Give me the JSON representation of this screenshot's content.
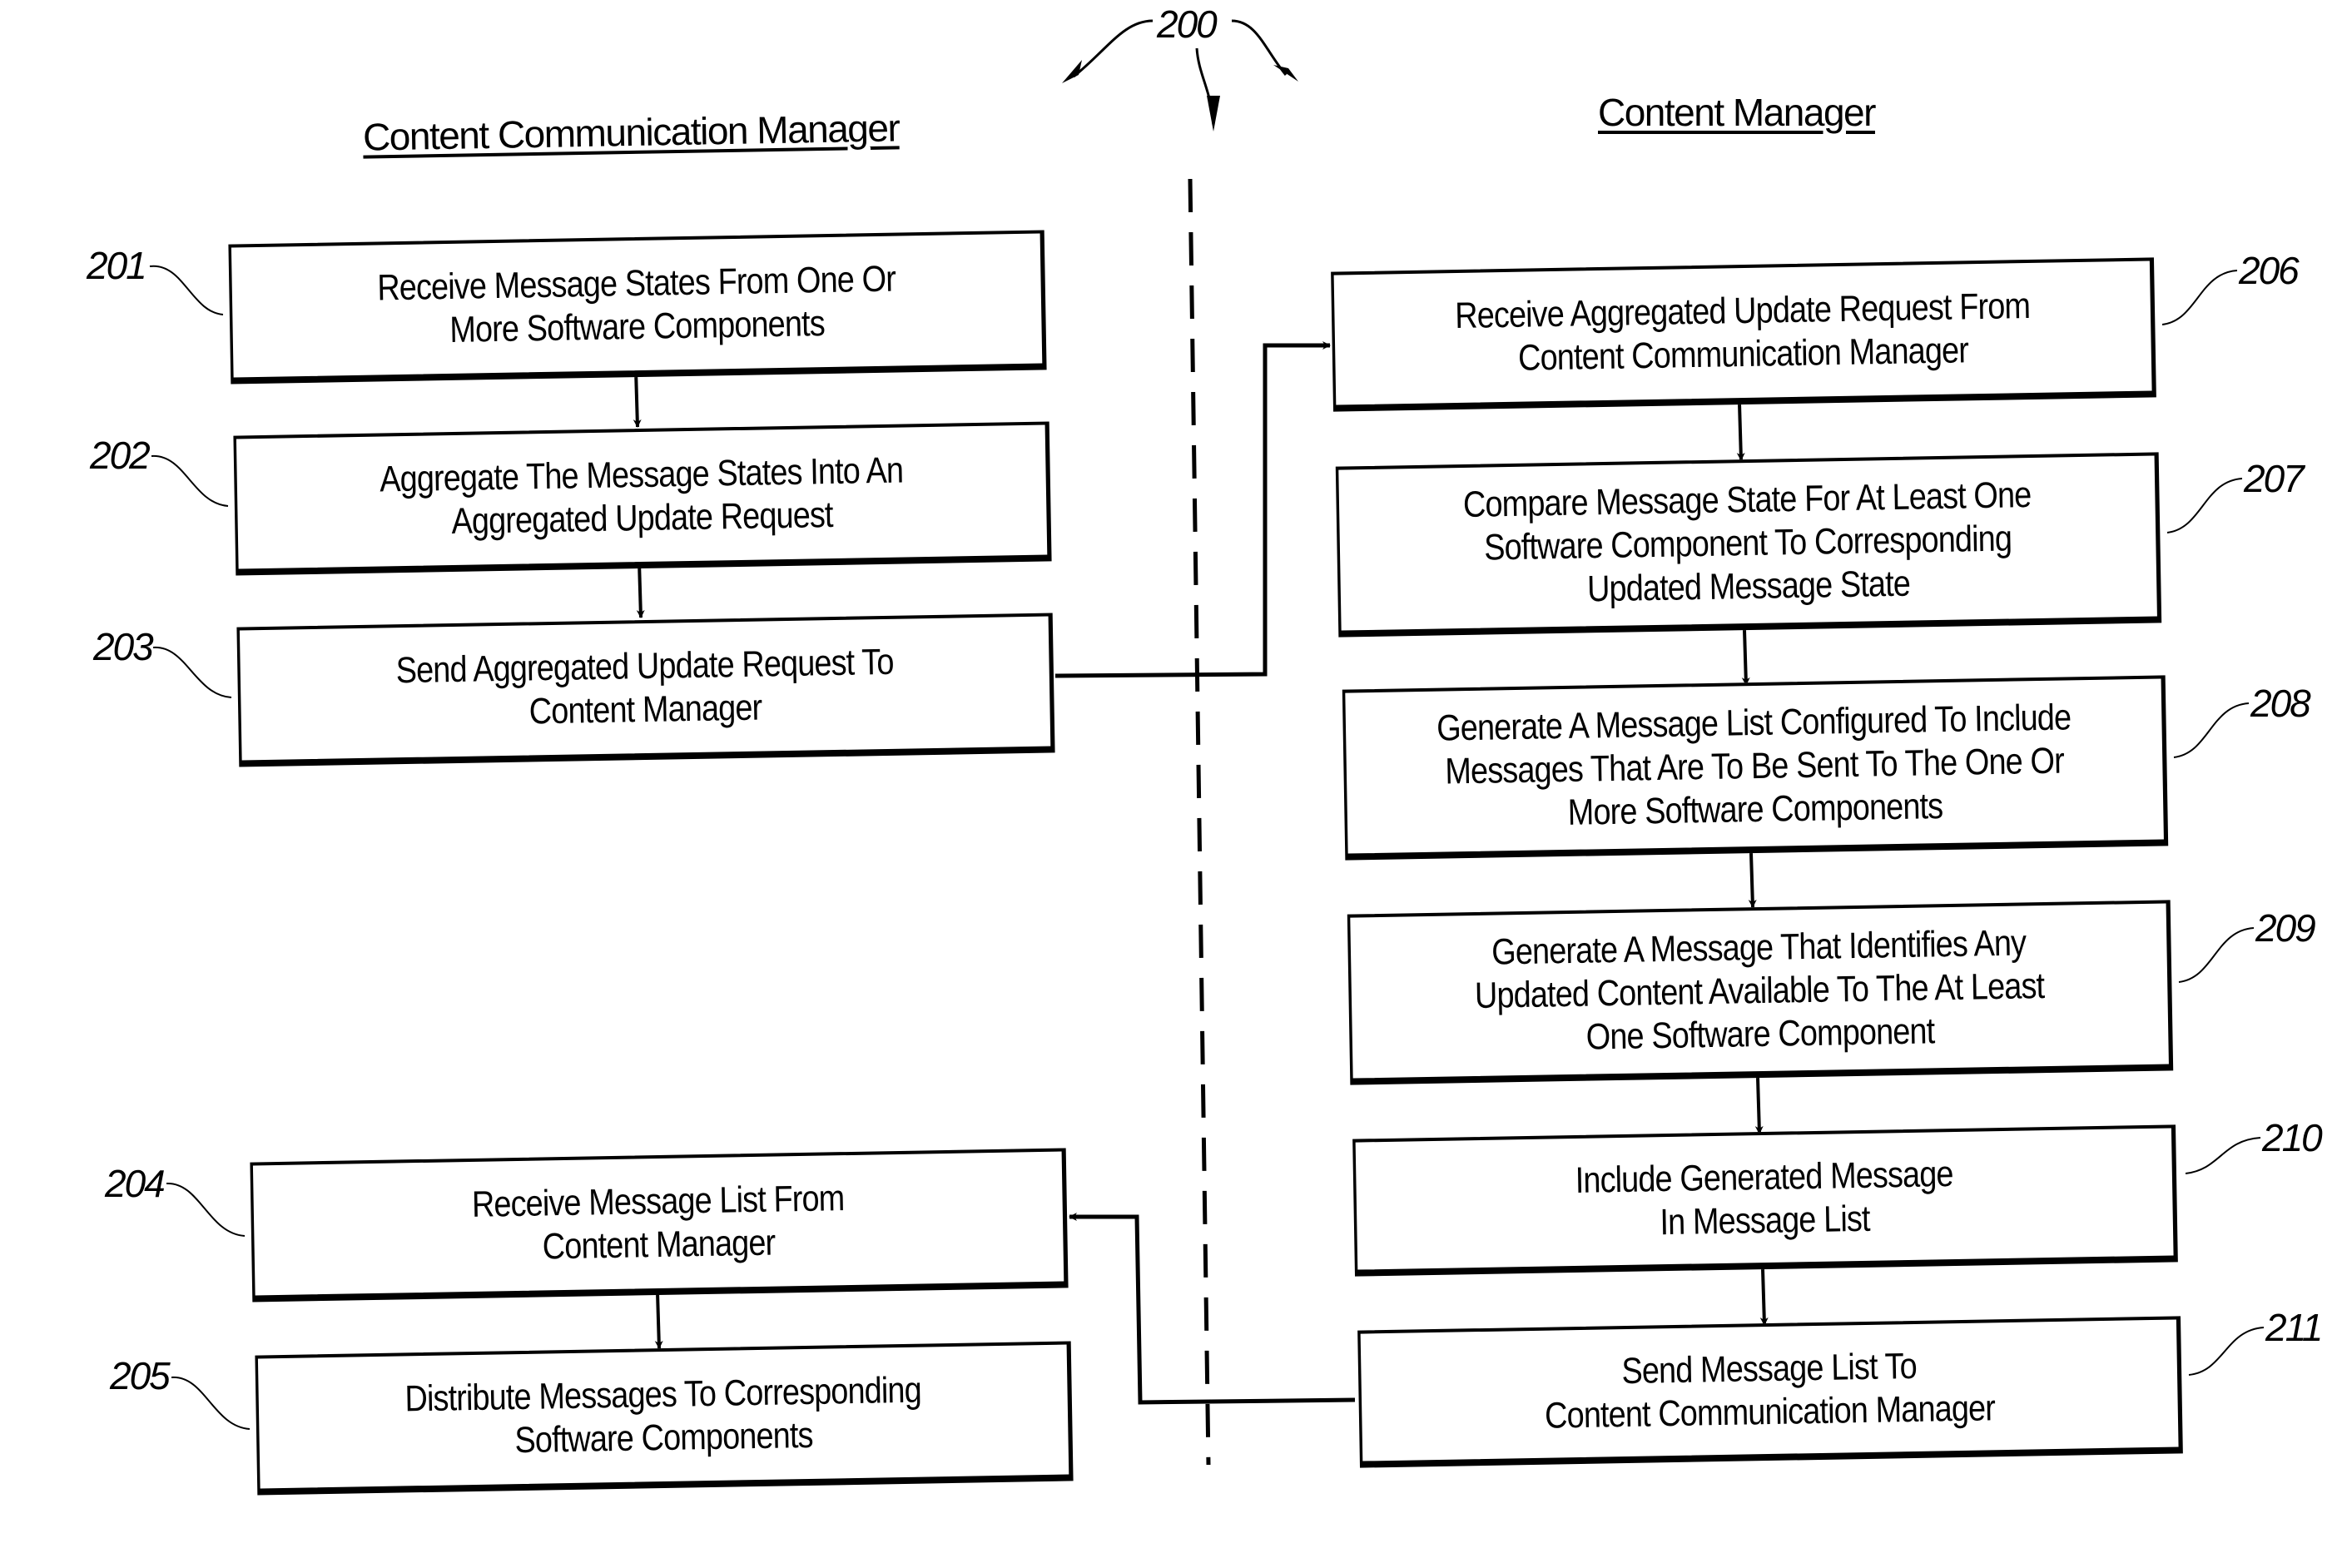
{
  "figure_ref": "200",
  "lanes": {
    "left_title": "Content Communication Manager",
    "right_title": "Content Manager"
  },
  "steps": [
    {
      "ref": "201",
      "text": "Receive Message States From One Or\nMore Software Components"
    },
    {
      "ref": "202",
      "text": "Aggregate The Message States Into An\nAggregated Update Request"
    },
    {
      "ref": "203",
      "text": "Send Aggregated Update Request To\nContent Manager"
    },
    {
      "ref": "204",
      "text": "Receive Message  List From\nContent Manager"
    },
    {
      "ref": "205",
      "text": "Distribute Messages To Corresponding\nSoftware Components"
    },
    {
      "ref": "206",
      "text": "Receive Aggregated Update Request From\nContent Communication Manager"
    },
    {
      "ref": "207",
      "text": "Compare Message State For At Least One\nSoftware Component To Corresponding\nUpdated Message State"
    },
    {
      "ref": "208",
      "text": "Generate A Message List Configured To Include\nMessages That Are To Be Sent To The One Or\nMore Software Components"
    },
    {
      "ref": "209",
      "text": "Generate A Message That Identifies Any\nUpdated Content Available To The At Least\nOne Software Component"
    },
    {
      "ref": "210",
      "text": "Include Generated Message\nIn Message List"
    },
    {
      "ref": "211",
      "text": "Send Message List To\nContent Communication Manager"
    }
  ]
}
